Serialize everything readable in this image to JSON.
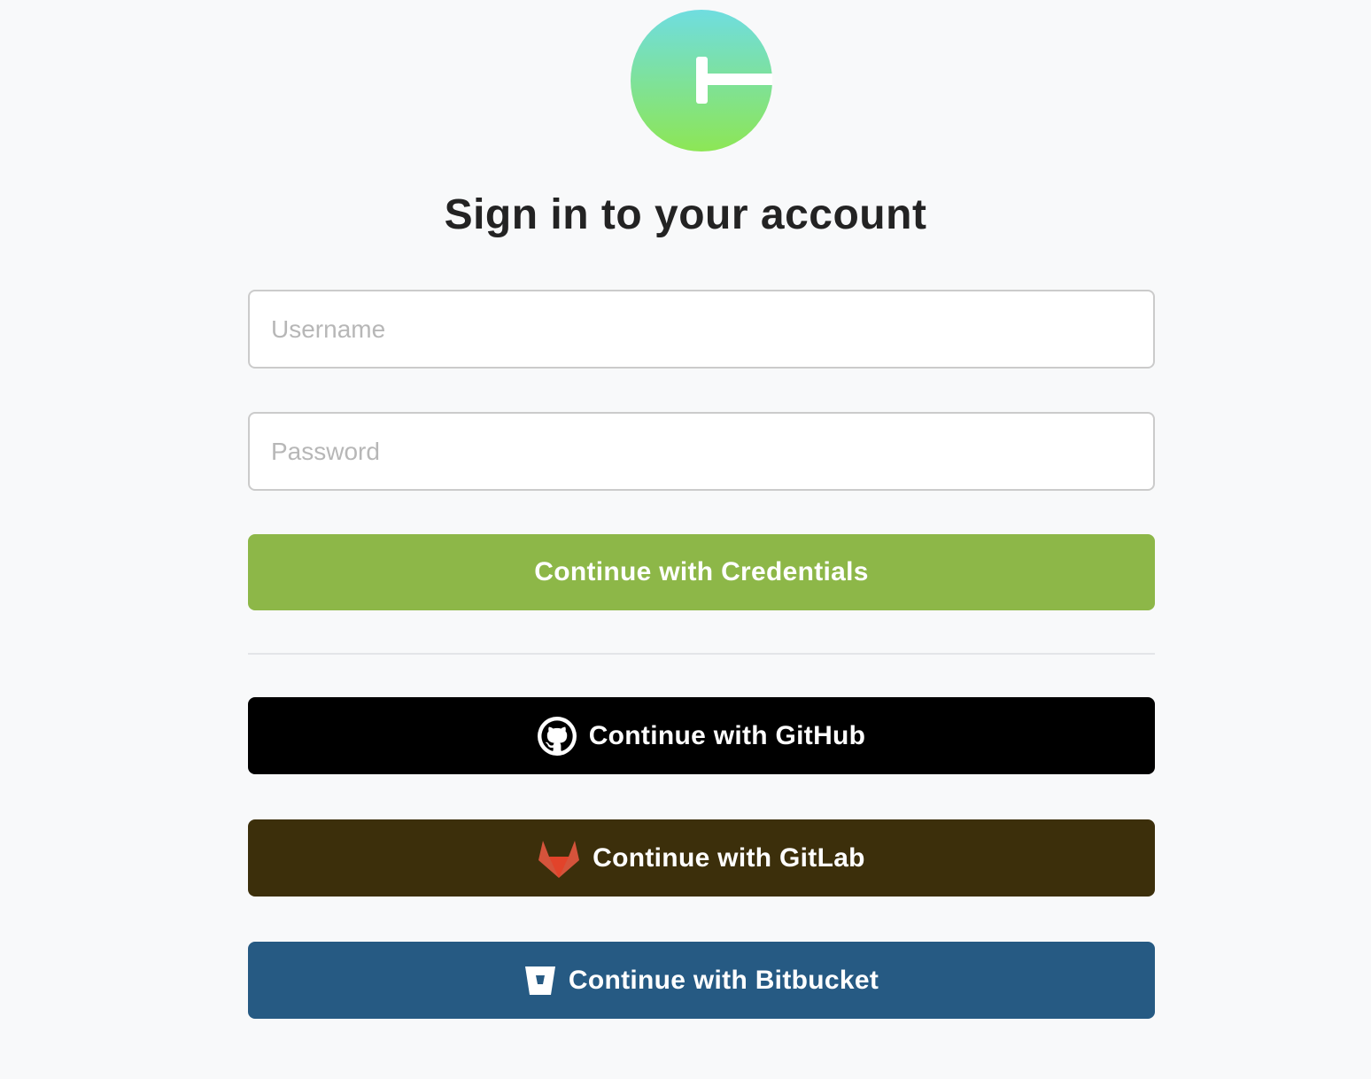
{
  "brand": {
    "logo_icon": "logo-circle-icon",
    "gradient_top": "#6fdde0",
    "gradient_bottom": "#8de655"
  },
  "page": {
    "title": "Sign in to your account"
  },
  "form": {
    "username_placeholder": "Username",
    "username_value": "",
    "password_placeholder": "Password",
    "password_value": ""
  },
  "buttons": {
    "credentials": {
      "label": "Continue with Credentials",
      "color": "#8db748"
    },
    "github": {
      "label": "Continue with GitHub",
      "icon": "github-icon",
      "color": "#000000"
    },
    "gitlab": {
      "label": "Continue with GitLab",
      "icon": "gitlab-icon",
      "color": "#3c2f0b"
    },
    "bitbucket": {
      "label": "Continue with Bitbucket",
      "icon": "bitbucket-icon",
      "color": "#265a83"
    }
  }
}
